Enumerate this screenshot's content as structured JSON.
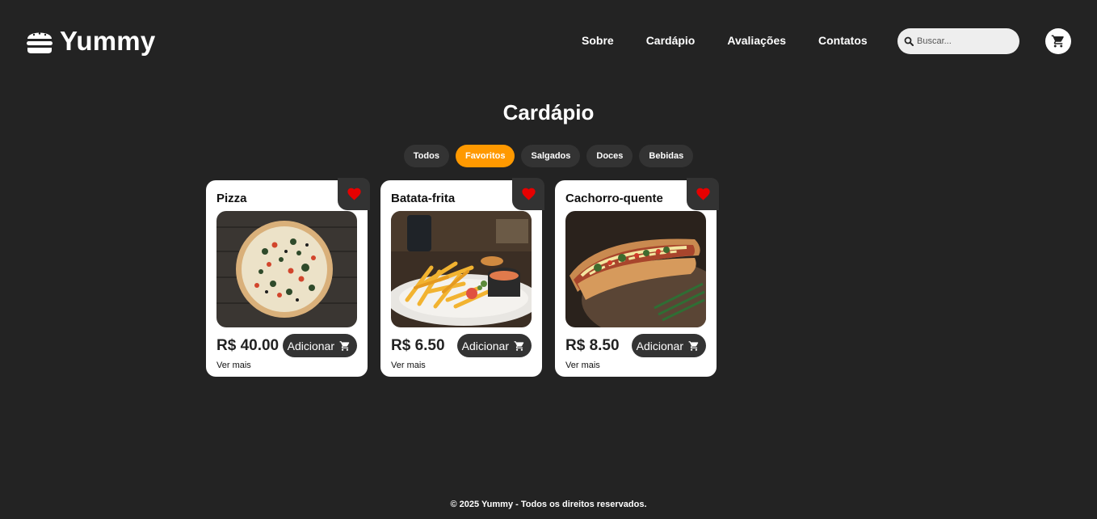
{
  "brand": {
    "name": "Yummy",
    "icon": "burger-icon"
  },
  "nav": {
    "items": [
      "Sobre",
      "Cardápio",
      "Avaliações",
      "Contatos"
    ]
  },
  "search": {
    "placeholder": "Buscar...",
    "value": ""
  },
  "header": {
    "cart_icon": "cart-icon"
  },
  "menu": {
    "title": "Cardápio",
    "filters": [
      "Todos",
      "Favoritos",
      "Salgados",
      "Doces",
      "Bebidas"
    ],
    "active_filter": "Favoritos",
    "products": [
      {
        "name": "Pizza",
        "price": "R$ 40.00",
        "add_label": "Adicionar",
        "more_label": "Ver mais",
        "favorite": true
      },
      {
        "name": "Batata-frita",
        "price": "R$ 6.50",
        "add_label": "Adicionar",
        "more_label": "Ver mais",
        "favorite": true
      },
      {
        "name": "Cachorro-quente",
        "price": "R$ 8.50",
        "add_label": "Adicionar",
        "more_label": "Ver mais",
        "favorite": true
      }
    ]
  },
  "footer": {
    "text": "© 2025 Yummy - Todos os direitos reservados."
  },
  "colors": {
    "background": "#232323",
    "accent": "#ff9900",
    "chip": "#333333",
    "heart": "#e60000"
  }
}
